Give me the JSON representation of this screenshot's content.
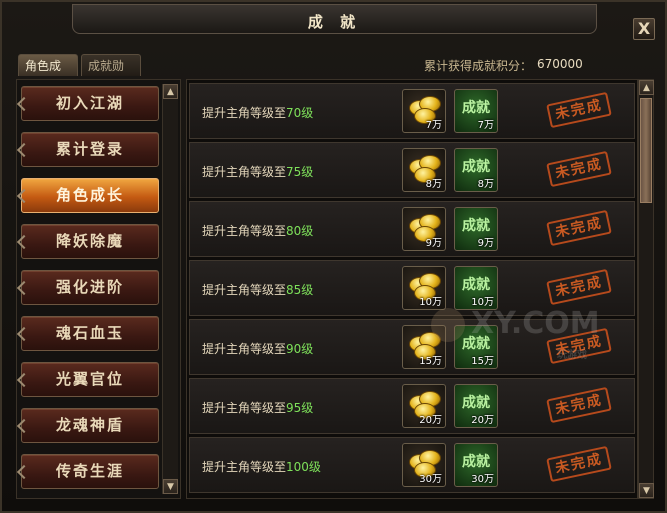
{
  "window": {
    "title": "成 就",
    "close_label": "X"
  },
  "tabs": [
    {
      "label": "角色成就",
      "active": true
    },
    {
      "label": "成就勋章",
      "active": false
    }
  ],
  "score": {
    "label": "累计获得成就积分：",
    "value": "670000"
  },
  "categories": [
    {
      "label": "初入江湖",
      "active": false
    },
    {
      "label": "累计登录",
      "active": false
    },
    {
      "label": "角色成长",
      "active": true
    },
    {
      "label": "降妖除魔",
      "active": false
    },
    {
      "label": "强化进阶",
      "active": false
    },
    {
      "label": "魂石血玉",
      "active": false
    },
    {
      "label": "光翼官位",
      "active": false
    },
    {
      "label": "龙魂神盾",
      "active": false
    },
    {
      "label": "传奇生涯",
      "active": false
    }
  ],
  "achievements": [
    {
      "prefix": "提升主角等级至",
      "level": "70级",
      "gold": "7万",
      "achieve_label": "成就",
      "points": "7万",
      "status": "未完成"
    },
    {
      "prefix": "提升主角等级至",
      "level": "75级",
      "gold": "8万",
      "achieve_label": "成就",
      "points": "8万",
      "status": "未完成"
    },
    {
      "prefix": "提升主角等级至",
      "level": "80级",
      "gold": "9万",
      "achieve_label": "成就",
      "points": "9万",
      "status": "未完成"
    },
    {
      "prefix": "提升主角等级至",
      "level": "85级",
      "gold": "10万",
      "achieve_label": "成就",
      "points": "10万",
      "status": "未完成"
    },
    {
      "prefix": "提升主角等级至",
      "level": "90级",
      "gold": "15万",
      "achieve_label": "成就",
      "points": "15万",
      "status": "未完成"
    },
    {
      "prefix": "提升主角等级至",
      "level": "95级",
      "gold": "20万",
      "achieve_label": "成就",
      "points": "20万",
      "status": "未完成"
    },
    {
      "prefix": "提升主角等级至",
      "level": "100级",
      "gold": "30万",
      "achieve_label": "成就",
      "points": "30万",
      "status": "未完成"
    }
  ],
  "watermark": {
    "text": "XY.COM",
    "sub": "玩游戏"
  },
  "icons": {
    "close": "close-icon",
    "gold": "gold-coins-icon",
    "achievement": "achievement-points-icon",
    "scroll_up": "scroll-up-icon",
    "scroll_down": "scroll-down-icon"
  },
  "colors": {
    "level_text": "#7ee05a",
    "stamp": "#c95a22",
    "active_category": "#e08a2a"
  }
}
